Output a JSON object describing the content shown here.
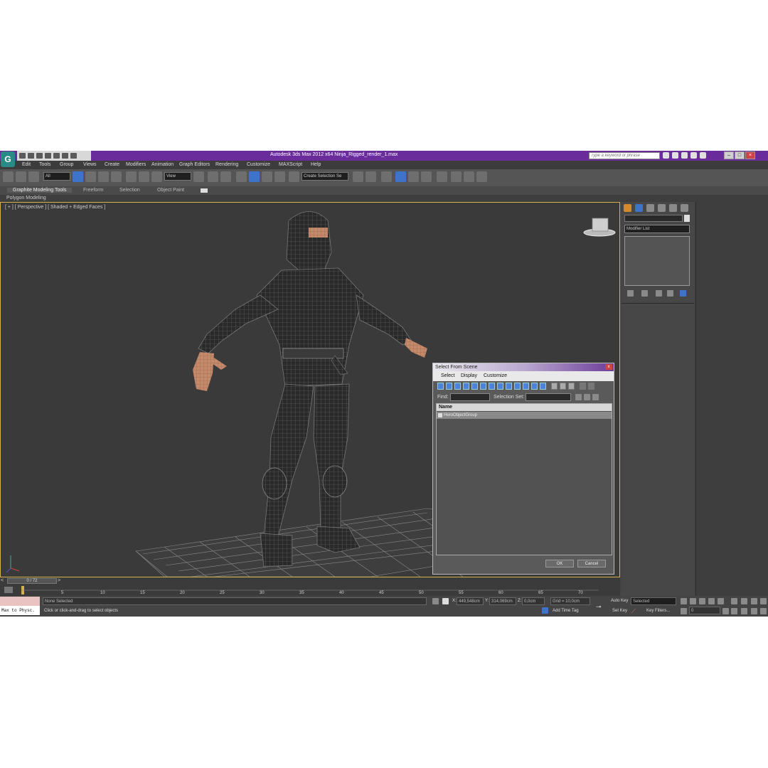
{
  "app": {
    "title": "Autodesk 3ds Max  2012 x64    Ninja_Rigged_render_1.max",
    "logo": "G",
    "search_placeholder": "Type a keyword or phrase"
  },
  "menu": [
    "Edit",
    "Tools",
    "Group",
    "Views",
    "Create",
    "Modifiers",
    "Animation",
    "Graph Editors",
    "Rendering",
    "Customize",
    "MAXScript",
    "Help"
  ],
  "toolbar": {
    "filter_value": "All",
    "ref_coord_value": "View",
    "selection_set_value": "Create Selection Se"
  },
  "ribbon": {
    "tabs": [
      "Graphite Modeling Tools",
      "Freeform",
      "Selection",
      "Object Paint"
    ],
    "subtab": "Polygon Modeling"
  },
  "viewport": {
    "label": "[ + ] [ Perspective ] [ Shaded + Edged Faces ]"
  },
  "command_panel": {
    "modifier_list": "Modifier List"
  },
  "dialog": {
    "title": "Select From Scene",
    "close": "x",
    "menu": [
      "Select",
      "Display",
      "Customize"
    ],
    "find_label": "Find:",
    "selection_set_label": "Selection Set:",
    "column_header": "Name",
    "rows": [
      "HeroObjectGroup"
    ],
    "ok": "OK",
    "cancel": "Cancel"
  },
  "timeline": {
    "frame_readout": "0 / 72",
    "ticks": [
      "5",
      "10",
      "15",
      "20",
      "25",
      "30",
      "35",
      "40",
      "45",
      "50",
      "55",
      "60",
      "65",
      "70"
    ]
  },
  "status": {
    "maxscript_label": "Max to Physc.",
    "selection": "None Selected",
    "prompt": "Click or click-and-drag to select objects",
    "x_label": "X:",
    "x_value": "449,548cm",
    "y_label": "Y:",
    "y_value": "314,069cm",
    "z_label": "Z:",
    "z_value": "0,0cm",
    "grid": "Grid = 10,0cm",
    "add_time_tag": "Add Time Tag",
    "auto_key": "Auto Key",
    "set_key": "Set Key",
    "key_mode_value": "Selected",
    "key_filters": "Key Filters...",
    "current_frame": "0"
  },
  "colors": {
    "title_bar": "#6a2c9a",
    "viewport_border": "#d6b04a",
    "selection_blue": "#3d74c9"
  }
}
